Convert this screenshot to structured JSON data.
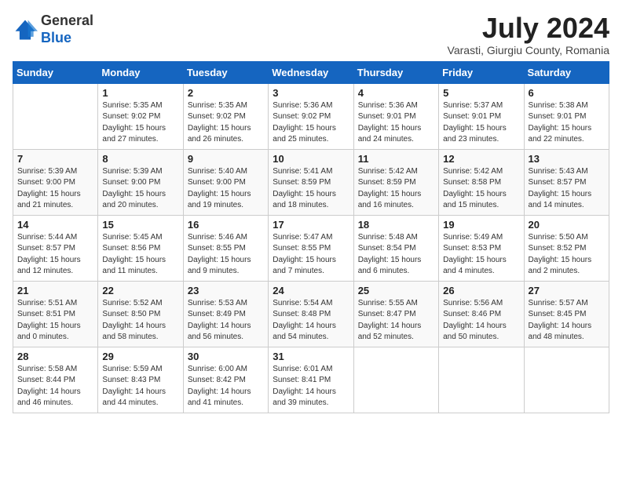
{
  "header": {
    "logo_line1": "General",
    "logo_line2": "Blue",
    "month_year": "July 2024",
    "subtitle": "Varasti, Giurgiu County, Romania"
  },
  "days_of_week": [
    "Sunday",
    "Monday",
    "Tuesday",
    "Wednesday",
    "Thursday",
    "Friday",
    "Saturday"
  ],
  "weeks": [
    [
      {
        "day": "",
        "info": ""
      },
      {
        "day": "1",
        "info": "Sunrise: 5:35 AM\nSunset: 9:02 PM\nDaylight: 15 hours\nand 27 minutes."
      },
      {
        "day": "2",
        "info": "Sunrise: 5:35 AM\nSunset: 9:02 PM\nDaylight: 15 hours\nand 26 minutes."
      },
      {
        "day": "3",
        "info": "Sunrise: 5:36 AM\nSunset: 9:02 PM\nDaylight: 15 hours\nand 25 minutes."
      },
      {
        "day": "4",
        "info": "Sunrise: 5:36 AM\nSunset: 9:01 PM\nDaylight: 15 hours\nand 24 minutes."
      },
      {
        "day": "5",
        "info": "Sunrise: 5:37 AM\nSunset: 9:01 PM\nDaylight: 15 hours\nand 23 minutes."
      },
      {
        "day": "6",
        "info": "Sunrise: 5:38 AM\nSunset: 9:01 PM\nDaylight: 15 hours\nand 22 minutes."
      }
    ],
    [
      {
        "day": "7",
        "info": "Sunrise: 5:39 AM\nSunset: 9:00 PM\nDaylight: 15 hours\nand 21 minutes."
      },
      {
        "day": "8",
        "info": "Sunrise: 5:39 AM\nSunset: 9:00 PM\nDaylight: 15 hours\nand 20 minutes."
      },
      {
        "day": "9",
        "info": "Sunrise: 5:40 AM\nSunset: 9:00 PM\nDaylight: 15 hours\nand 19 minutes."
      },
      {
        "day": "10",
        "info": "Sunrise: 5:41 AM\nSunset: 8:59 PM\nDaylight: 15 hours\nand 18 minutes."
      },
      {
        "day": "11",
        "info": "Sunrise: 5:42 AM\nSunset: 8:59 PM\nDaylight: 15 hours\nand 16 minutes."
      },
      {
        "day": "12",
        "info": "Sunrise: 5:42 AM\nSunset: 8:58 PM\nDaylight: 15 hours\nand 15 minutes."
      },
      {
        "day": "13",
        "info": "Sunrise: 5:43 AM\nSunset: 8:57 PM\nDaylight: 15 hours\nand 14 minutes."
      }
    ],
    [
      {
        "day": "14",
        "info": "Sunrise: 5:44 AM\nSunset: 8:57 PM\nDaylight: 15 hours\nand 12 minutes."
      },
      {
        "day": "15",
        "info": "Sunrise: 5:45 AM\nSunset: 8:56 PM\nDaylight: 15 hours\nand 11 minutes."
      },
      {
        "day": "16",
        "info": "Sunrise: 5:46 AM\nSunset: 8:55 PM\nDaylight: 15 hours\nand 9 minutes."
      },
      {
        "day": "17",
        "info": "Sunrise: 5:47 AM\nSunset: 8:55 PM\nDaylight: 15 hours\nand 7 minutes."
      },
      {
        "day": "18",
        "info": "Sunrise: 5:48 AM\nSunset: 8:54 PM\nDaylight: 15 hours\nand 6 minutes."
      },
      {
        "day": "19",
        "info": "Sunrise: 5:49 AM\nSunset: 8:53 PM\nDaylight: 15 hours\nand 4 minutes."
      },
      {
        "day": "20",
        "info": "Sunrise: 5:50 AM\nSunset: 8:52 PM\nDaylight: 15 hours\nand 2 minutes."
      }
    ],
    [
      {
        "day": "21",
        "info": "Sunrise: 5:51 AM\nSunset: 8:51 PM\nDaylight: 15 hours\nand 0 minutes."
      },
      {
        "day": "22",
        "info": "Sunrise: 5:52 AM\nSunset: 8:50 PM\nDaylight: 14 hours\nand 58 minutes."
      },
      {
        "day": "23",
        "info": "Sunrise: 5:53 AM\nSunset: 8:49 PM\nDaylight: 14 hours\nand 56 minutes."
      },
      {
        "day": "24",
        "info": "Sunrise: 5:54 AM\nSunset: 8:48 PM\nDaylight: 14 hours\nand 54 minutes."
      },
      {
        "day": "25",
        "info": "Sunrise: 5:55 AM\nSunset: 8:47 PM\nDaylight: 14 hours\nand 52 minutes."
      },
      {
        "day": "26",
        "info": "Sunrise: 5:56 AM\nSunset: 8:46 PM\nDaylight: 14 hours\nand 50 minutes."
      },
      {
        "day": "27",
        "info": "Sunrise: 5:57 AM\nSunset: 8:45 PM\nDaylight: 14 hours\nand 48 minutes."
      }
    ],
    [
      {
        "day": "28",
        "info": "Sunrise: 5:58 AM\nSunset: 8:44 PM\nDaylight: 14 hours\nand 46 minutes."
      },
      {
        "day": "29",
        "info": "Sunrise: 5:59 AM\nSunset: 8:43 PM\nDaylight: 14 hours\nand 44 minutes."
      },
      {
        "day": "30",
        "info": "Sunrise: 6:00 AM\nSunset: 8:42 PM\nDaylight: 14 hours\nand 41 minutes."
      },
      {
        "day": "31",
        "info": "Sunrise: 6:01 AM\nSunset: 8:41 PM\nDaylight: 14 hours\nand 39 minutes."
      },
      {
        "day": "",
        "info": ""
      },
      {
        "day": "",
        "info": ""
      },
      {
        "day": "",
        "info": ""
      }
    ]
  ]
}
